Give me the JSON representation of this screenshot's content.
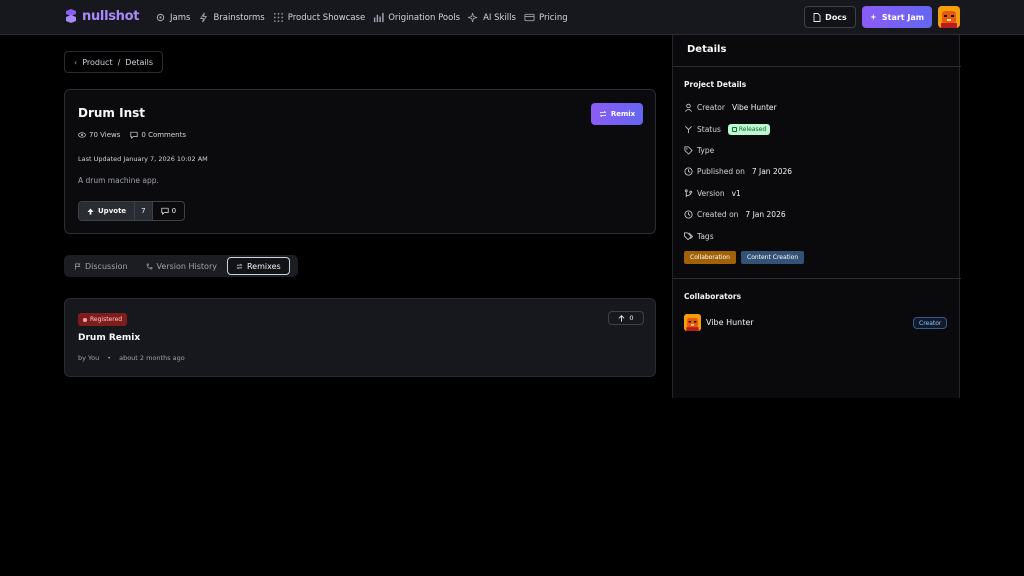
{
  "brand": {
    "name": "nullshot",
    "accent": "#a78bfa"
  },
  "nav": {
    "items": [
      {
        "label": "Jams",
        "icon": "gear-icon"
      },
      {
        "label": "Brainstorms",
        "icon": "bolt-icon"
      },
      {
        "label": "Product Showcase",
        "icon": "grid-icon"
      },
      {
        "label": "Origination Pools",
        "icon": "bar-chart-icon"
      },
      {
        "label": "AI Skills",
        "icon": "sparkles-icon"
      },
      {
        "label": "Pricing",
        "icon": "card-icon"
      }
    ],
    "docs_label": "Docs",
    "start_jam_label": "Start Jam"
  },
  "breadcrumb": {
    "parent": "Product",
    "separator": "/",
    "current": "Details"
  },
  "project": {
    "title": "Drum Inst",
    "remix_label": "Remix",
    "views": "70 Views",
    "comments": "0 Comments",
    "last_updated": "Last Updated January 7, 2026 10:02 AM",
    "description": "A drum machine app.",
    "upvote_label": "Upvote",
    "upvote_count": "7",
    "comment_count": "0"
  },
  "tabs": [
    {
      "label": "Discussion",
      "active": false
    },
    {
      "label": "Version History",
      "active": false
    },
    {
      "label": "Remixes",
      "active": true
    }
  ],
  "remix": {
    "badge": "Registered",
    "title": "Drum Remix",
    "by": "by You",
    "time": "about 2 months ago",
    "votes": "0"
  },
  "details": {
    "title": "Details",
    "section_project": "Project Details",
    "creator_label": "Creator",
    "creator_value": "Vibe Hunter",
    "status_label": "Status",
    "status_value": "Released",
    "type_label": "Type",
    "published_label": "Published on",
    "published_value": "7 Jan 2026",
    "version_label": "Version",
    "version_value": "v1",
    "created_label": "Created on",
    "created_value": "7 Jan 2026",
    "tags_label": "Tags",
    "tags": [
      "Collaboration",
      "Content Creation"
    ],
    "section_collaborators": "Collaborators",
    "collaborator_name": "Vibe Hunter",
    "collaborator_role": "Creator"
  }
}
